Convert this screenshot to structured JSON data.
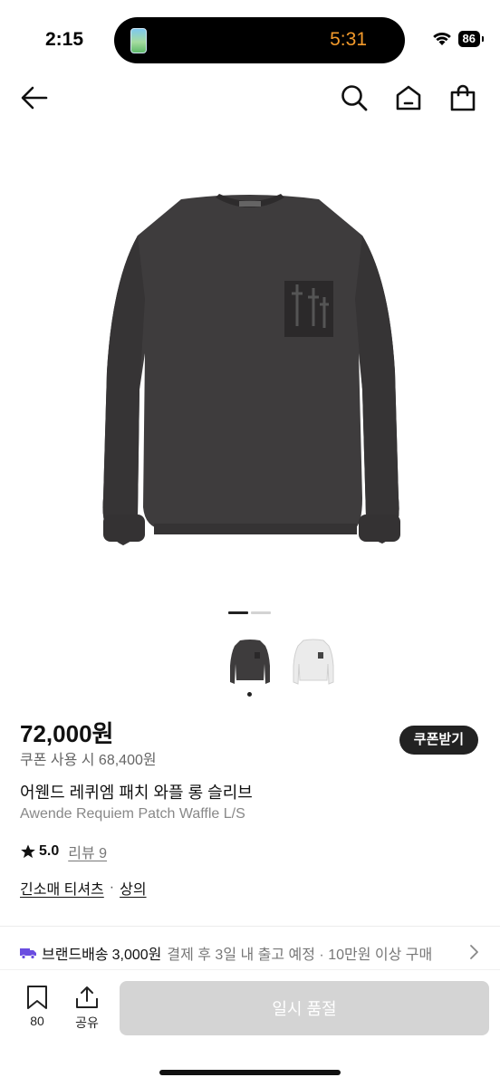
{
  "status": {
    "time": "2:15",
    "timer": "5:31",
    "battery": "86"
  },
  "nav": {
    "icons": [
      "back-arrow-icon",
      "search-icon",
      "home-icon",
      "shopping-bag-icon"
    ]
  },
  "product": {
    "price": "72,000원",
    "coupon_price": "쿠폰 사용 시 68,400원",
    "coupon_button": "쿠폰받기",
    "title_ko": "어웬드 레퀴엠 패치 와플 롱 슬리브",
    "title_en": "Awende Requiem Patch Waffle L/S",
    "rating": "5.0",
    "reviews": "리뷰 9",
    "category": [
      "긴소매 티셔츠",
      "상의"
    ],
    "category_separator": "·",
    "colors": {
      "shirt_dark": "#3e3c3d",
      "shirt_light": "#e9e9e9"
    }
  },
  "gallery": {
    "page": 1,
    "pages": 2
  },
  "shipping": {
    "brand": "브랜드배송",
    "fee": "3,000원",
    "detail": "결제 후 3일 내 출고 예정 · 10만원 이상 구매"
  },
  "bottom_bar": {
    "like_count": "80",
    "share_label": "공유",
    "soldout_label": "일시 품절"
  }
}
